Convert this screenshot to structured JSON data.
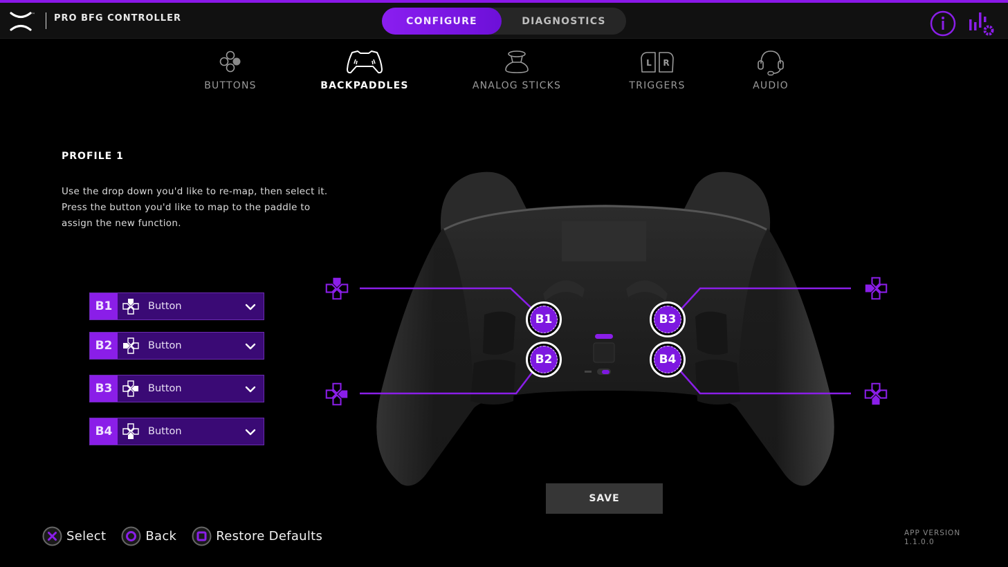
{
  "header": {
    "app_title": "PRO BFG CONTROLLER",
    "trademark": "™",
    "modes": [
      {
        "label": "CONFIGURE",
        "active": true
      },
      {
        "label": "DIAGNOSTICS",
        "active": false
      }
    ],
    "icons": {
      "info": "info-icon",
      "settings": "equalizer-gear-icon"
    }
  },
  "categories": [
    {
      "label": "BUTTONS",
      "icon": "face-buttons-icon",
      "active": false
    },
    {
      "label": "BACKPADDLES",
      "icon": "controller-icon",
      "active": true
    },
    {
      "label": "ANALOG STICKS",
      "icon": "analog-stick-icon",
      "active": false
    },
    {
      "label": "TRIGGERS",
      "icon": "triggers-icon",
      "active": false,
      "icon_letters": [
        "L",
        "R"
      ]
    },
    {
      "label": "AUDIO",
      "icon": "headset-icon",
      "active": false
    }
  ],
  "profile": {
    "title": "PROFILE 1",
    "instructions": "Use the drop down you'd like to re-map, then select it. Press the button you'd like to map to the paddle to assign the new function."
  },
  "paddles": [
    {
      "id": "B1",
      "value": "Button",
      "dpad_highlight": "up"
    },
    {
      "id": "B2",
      "value": "Button",
      "dpad_highlight": "left"
    },
    {
      "id": "B3",
      "value": "Button",
      "dpad_highlight": "right"
    },
    {
      "id": "B4",
      "value": "Button",
      "dpad_highlight": "down"
    }
  ],
  "save_label": "SAVE",
  "hints": [
    {
      "label": "Select",
      "icon": "cross-button-icon"
    },
    {
      "label": "Back",
      "icon": "circle-button-icon"
    },
    {
      "label": "Restore Defaults",
      "icon": "square-button-icon"
    }
  ],
  "version": {
    "label": "APP VERSION",
    "value": "1.1.0.0"
  },
  "colors": {
    "accent": "#8a1ee8",
    "accent_dark": "#3a0a75",
    "background": "#000000",
    "header": "#111111"
  }
}
